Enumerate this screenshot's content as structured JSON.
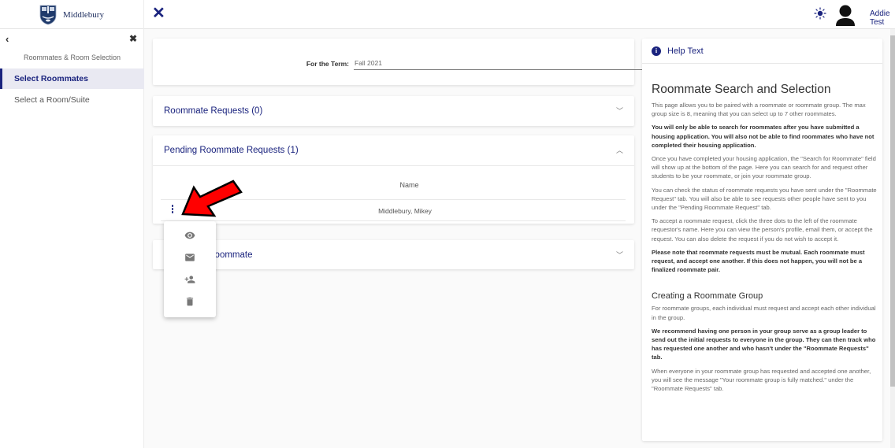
{
  "header": {
    "logo_text": "Middlebury",
    "close_icon": "close-icon",
    "theme_icon": "sun-icon",
    "avatar_icon": "person-icon",
    "username": "Addie Test"
  },
  "sidebar": {
    "back_icon": "chevron-left-icon",
    "close_icon": "close-icon",
    "section_title": "Roommates & Room Selection",
    "items": [
      {
        "label": "Select Roommates",
        "active": true
      },
      {
        "label": "Select a Room/Suite",
        "active": false
      }
    ]
  },
  "term": {
    "label": "For the Term:",
    "value": "Fall 2021"
  },
  "panels": {
    "roommate_requests": {
      "title": "Roommate Requests (0)",
      "expanded": false
    },
    "pending_requests": {
      "title": "Pending Roommate Requests (1)",
      "expanded": true,
      "column_header": "Name",
      "rows": [
        {
          "name": "Middlebury, Mikey"
        }
      ]
    },
    "search_roommate": {
      "title": "Search for Roommate",
      "visible_title": "ommate",
      "expanded": false
    }
  },
  "action_menu": {
    "items": [
      {
        "icon": "eye-icon",
        "action": "view-profile"
      },
      {
        "icon": "mail-icon",
        "action": "email"
      },
      {
        "icon": "person-add-icon",
        "action": "accept-request"
      },
      {
        "icon": "trash-icon",
        "action": "delete-request"
      }
    ]
  },
  "help": {
    "title": "Help Text",
    "heading": "Roommate Search and Selection",
    "paragraphs": [
      {
        "text": "This page allows you to be paired with a roommate or roommate group. The max group size is 8, meaning that you can select up to 7 other roommates.",
        "bold": false
      },
      {
        "text": "You will only be able to search for roommates after you have submitted a housing application. You will also not be able to find roommates who have not completed their housing application.",
        "bold": true
      },
      {
        "text": "Once you have completed your housing application, the \"Search for Roommate\" field will show up at the bottom of the page. Here you can search for and request other students to be your roommate, or join your roommate group.",
        "bold": false
      },
      {
        "text": "You can check the status of roommate requests you have sent under the \"Roommate Request\" tab. You will also be able to see requests other people have sent to you under the \"Pending Roommate Request\" tab.",
        "bold": false
      },
      {
        "text": "To accept a roommate request, click the three dots to the left of the roommate requestor's name. Here you can view the person's profile, email them, or accept the request. You can also delete the request if you do not wish to accept it.",
        "bold": false
      },
      {
        "text": "Please note that roommate requests must be mutual. Each roommate must request, and accept one another. If this does not happen, you will not be a finalized roommate pair.",
        "bold": true
      }
    ],
    "subheading": "Creating a Roommate Group",
    "group_paragraphs": [
      {
        "text": "For roommate groups, each individual must request and accept each other individual in the group.",
        "bold": false
      },
      {
        "text": "We recommend having one person in your group serve as a group leader to send out the initial requests to everyone in the group. They can then track who has requested one another and who hasn't under the \"Roommate Requests\" tab.",
        "bold": true
      },
      {
        "text": "When everyone in your roommate group has requested and accepted one another, you will see the message \"Your roommate group is fully matched.\" under the \"Roommate Requests\" tab.",
        "bold": false
      }
    ]
  },
  "colors": {
    "accent": "#1a237e",
    "annotation_arrow": "#ff0000"
  }
}
